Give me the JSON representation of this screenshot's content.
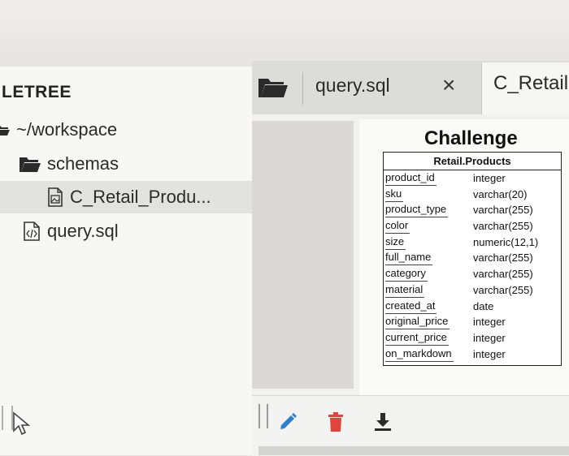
{
  "sidebar": {
    "title": "LETREE",
    "items": [
      {
        "label": "~/workspace",
        "icon": "folder-open-icon"
      },
      {
        "label": "schemas",
        "icon": "folder-open-icon"
      },
      {
        "label": "C_Retail_Produ...",
        "icon": "image-file-icon",
        "selected": true
      },
      {
        "label": "query.sql",
        "icon": "code-file-icon"
      }
    ]
  },
  "tabs": [
    {
      "label": "query.sql"
    },
    {
      "label": "C_Retail",
      "active": true
    }
  ],
  "tab_close": "×",
  "document": {
    "title": "Challenge",
    "table_name": "Retail.Products",
    "columns": [
      {
        "name": "product_id",
        "type": "integer"
      },
      {
        "name": "sku",
        "type": "varchar(20)"
      },
      {
        "name": "product_type",
        "type": "varchar(255)"
      },
      {
        "name": "color",
        "type": "varchar(255)"
      },
      {
        "name": "size",
        "type": "numeric(12,1)"
      },
      {
        "name": "full_name",
        "type": "varchar(255)"
      },
      {
        "name": "category",
        "type": "varchar(255)"
      },
      {
        "name": "material",
        "type": "varchar(255)"
      },
      {
        "name": "created_at",
        "type": "date"
      },
      {
        "name": "original_price",
        "type": "integer"
      },
      {
        "name": "current_price",
        "type": "integer"
      },
      {
        "name": "on_markdown",
        "type": "integer"
      }
    ]
  },
  "actions": [
    {
      "icon": "pencil-icon",
      "color": "#2f7fd1"
    },
    {
      "icon": "trash-icon",
      "color": "#e0443a"
    },
    {
      "icon": "download-icon",
      "color": "#2b2b2b"
    }
  ]
}
